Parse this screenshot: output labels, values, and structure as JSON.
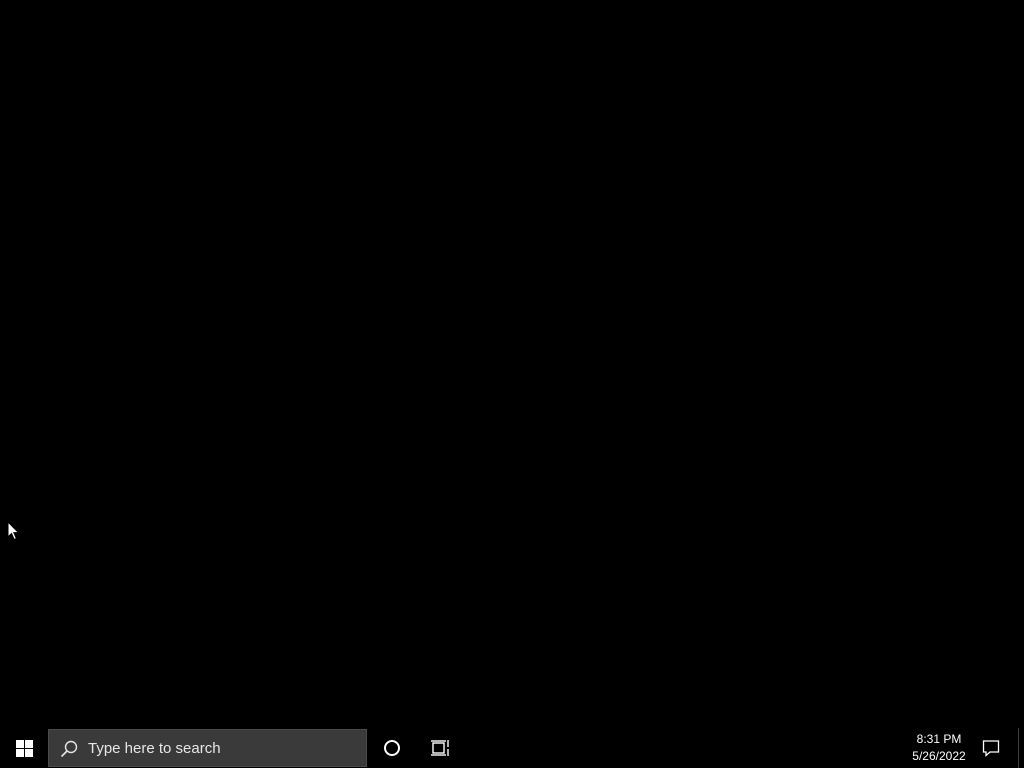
{
  "taskbar": {
    "start_icon": "windows-logo-icon",
    "search": {
      "placeholder": "Type here to search",
      "icon": "search-icon"
    },
    "cortana_icon": "cortana-circle-icon",
    "taskview_icon": "task-view-icon",
    "clock": {
      "time": "8:31 PM",
      "date": "5/26/2022"
    },
    "notification_icon": "action-center-icon"
  },
  "colors": {
    "desktop_background": "#000000",
    "taskbar_background": "#000000",
    "search_background": "#3a3a3a",
    "text": "#ffffff"
  }
}
